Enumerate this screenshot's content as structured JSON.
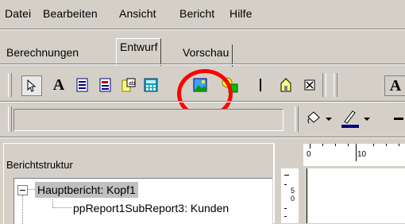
{
  "menu": {
    "items": [
      {
        "label": "Datei"
      },
      {
        "label": "Bearbeiten"
      },
      {
        "label": "Ansicht"
      },
      {
        "label": "Bericht"
      },
      {
        "label": "Hilfe"
      }
    ]
  },
  "tabs": [
    {
      "label": "Berechnungen"
    },
    {
      "label": "Entwurf"
    },
    {
      "label": "Vorschau"
    }
  ],
  "toolbar": {
    "icons": [
      "pointer-icon",
      "label-text-icon",
      "memo-icon",
      "rich-text-icon",
      "db-field-icon",
      "calc-icon",
      "image-icon",
      "shape-icon",
      "line-icon",
      "subreport-icon",
      "checkbox-icon"
    ],
    "font_button": "A"
  },
  "panel": {
    "title": "Berichtstruktur",
    "tree": [
      {
        "label": "Hauptbericht: Kopf1",
        "selected": true
      },
      {
        "label": "ppReport1SubReport3: Kunden",
        "selected": false
      }
    ]
  },
  "ruler": {
    "labels": [
      "0",
      "10"
    ]
  },
  "vruler": {
    "labels": [
      "5",
      "0"
    ]
  },
  "colors": {
    "highlight": "#ff0000",
    "selection": "#c0c0c0",
    "face": "#d4d0c8"
  }
}
